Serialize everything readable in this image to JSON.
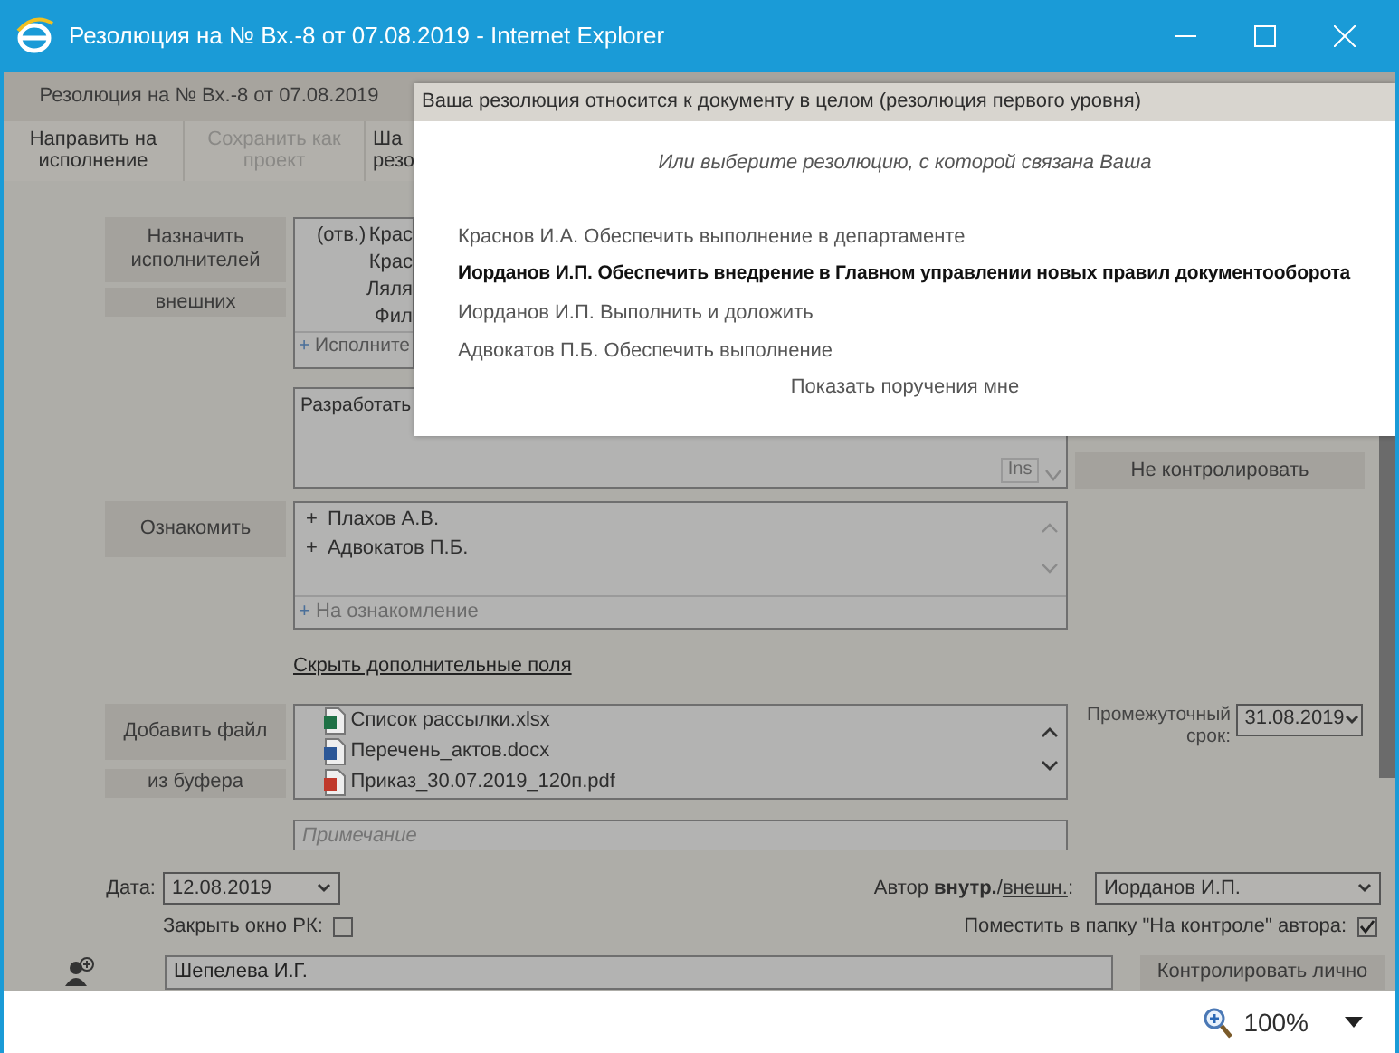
{
  "window": {
    "title": "Резолюция на № Вх.-8 от 07.08.2019 - Internet Explorer"
  },
  "header": {
    "tab": "Резолюция на № Вх.-8 от 07.08.2019"
  },
  "toolbar": [
    {
      "lines": [
        "Направить на",
        "исполнение"
      ],
      "disabled": false
    },
    {
      "lines": [
        "Сохранить как",
        "проект"
      ],
      "disabled": true
    },
    {
      "lines": [
        "Ша",
        "резо"
      ],
      "disabled": false
    }
  ],
  "executors": {
    "button": "Назначить исполнителей",
    "external_button": "внешних",
    "rows": [
      {
        "prefix": "(отв.)",
        "name": "Крас"
      },
      {
        "prefix": "",
        "name": "Крас"
      },
      {
        "prefix": "",
        "name": "Ляля"
      },
      {
        "prefix": "",
        "name": "Фил"
      }
    ],
    "add": {
      "sign": "+",
      "label": "Исполните"
    }
  },
  "task": {
    "text": "Разработать",
    "ins": "Ins",
    "control_button": "Не контролировать"
  },
  "acquaint": {
    "button": "Ознакомить",
    "rows": [
      {
        "sign": "+",
        "name": "Плахов А.В."
      },
      {
        "sign": "+",
        "name": "Адвокатов П.Б."
      }
    ],
    "add": {
      "sign": "+",
      "label": "На ознакомление"
    }
  },
  "hide_link": "Скрыть дополнительные поля",
  "files": {
    "button": "Добавить файл",
    "clipboard_button": "из буфера",
    "items": [
      {
        "name": "Список рассылки.xlsx",
        "kind": "excel"
      },
      {
        "name": "Перечень_актов.docx",
        "kind": "word"
      },
      {
        "name": "Приказ_30.07.2019_120п.pdf",
        "kind": "pdf"
      }
    ]
  },
  "interim": {
    "label": "Промежуточный срок:",
    "value": "31.08.2019"
  },
  "note": {
    "placeholder": "Примечание"
  },
  "bottom": {
    "date": {
      "label": "Дата:",
      "value": "12.08.2019"
    },
    "close_card": {
      "label": "Закрыть окно РК:",
      "checked": false
    },
    "author": {
      "label": "Автор **внутр.**/",
      "link": "внешн.",
      "suffix": ":",
      "value": "Иорданов И.П."
    },
    "control_folder": {
      "label": "Поместить в папку \"На контроле\" автора:",
      "checked": true
    },
    "controller": {
      "value": "Шепелева И.Г.",
      "button": "Контролировать лично"
    }
  },
  "status_bar": {
    "zoom": "100%"
  },
  "popup": {
    "link": "Ваша резолюция относится к документу в целом (резолюция первого уровня)",
    "prompt": "Или выберите резолюцию, с которой связана Ваша",
    "items": [
      {
        "text": "Краснов И.А. Обеспечить выполнение в департаменте",
        "selected": false
      },
      {
        "text": "Иорданов И.П. Обеспечить внедрение в Главном управлении новых правил документооборота",
        "selected": true
      },
      {
        "text": "Иорданов И.П. Выполнить и доложить",
        "selected": false
      },
      {
        "text": "Адвокатов П.Б. Обеспечить выполнение",
        "selected": false
      }
    ],
    "show_link": "Показать поручения мне"
  }
}
